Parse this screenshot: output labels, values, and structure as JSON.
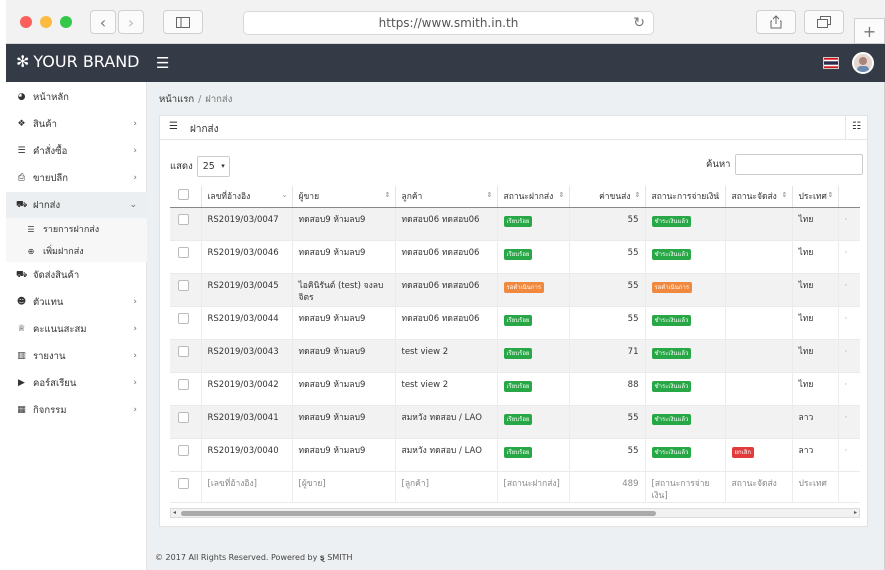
{
  "browser": {
    "url": "https://www.smith.in.th"
  },
  "topbar": {
    "brand": "YOUR BRAND"
  },
  "sidebar": {
    "items": [
      {
        "label": "หน้าหลัก",
        "icon": "dashboard-icon"
      },
      {
        "label": "สินค้า",
        "icon": "cubes-icon"
      },
      {
        "label": "คำสั่งซื้อ",
        "icon": "list-icon"
      },
      {
        "label": "ขายปลีก",
        "icon": "printer-icon"
      },
      {
        "label": "ฝากส่ง",
        "icon": "cart-icon"
      },
      {
        "label": "จัดส่งสินค้า",
        "icon": "truck-icon"
      },
      {
        "label": "ตัวแทน",
        "icon": "users-icon"
      },
      {
        "label": "คะแนนสะสม",
        "icon": "trophy-icon"
      },
      {
        "label": "รายงาน",
        "icon": "chart-icon"
      },
      {
        "label": "คอร์สเรียน",
        "icon": "play-icon"
      },
      {
        "label": "กิจกรรม",
        "icon": "calendar-icon"
      }
    ],
    "subitems": [
      {
        "label": "รายการฝากส่ง",
        "icon": "list-icon"
      },
      {
        "label": "เพิ่มฝากส่ง",
        "icon": "plus-circle-icon"
      }
    ]
  },
  "breadcrumb": {
    "home": "หน้าแรก",
    "current": "ฝากส่ง"
  },
  "card": {
    "title": "ฝากส่ง"
  },
  "table_controls": {
    "show_label": "แสดง",
    "page_length": "25",
    "search_label": "ค้นหา"
  },
  "table": {
    "headers": [
      "เลขที่อ้างอิง",
      "ผู้ขาย",
      "ลูกค้า",
      "สถานะฝากส่ง",
      "ค่าขนส่ง",
      "สถานะการจ่ายเงิน",
      "สถานะจัดส่ง",
      "ประเทศ"
    ],
    "rows": [
      {
        "ref": "RS2019/03/0047",
        "seller": "ทดสอบ9 ห้ามลบ9",
        "customer": "ทดสอบ06 ทดสอบ06",
        "status": "เรียบร้อย",
        "status_color": "#27a745",
        "shipping": "55",
        "payment": "ชำระเงินแล้ว",
        "delivery": "",
        "country": "ไทย"
      },
      {
        "ref": "RS2019/03/0046",
        "seller": "ทดสอบ9 ห้ามลบ9",
        "customer": "ทดสอบ06 ทดสอบ06",
        "status": "เรียบร้อย",
        "status_color": "#27a745",
        "shipping": "55",
        "payment": "ชำระเงินแล้ว",
        "delivery": "",
        "country": "ไทย"
      },
      {
        "ref": "RS2019/03/0045",
        "seller": "ไอคินิรันต์ (test) จงลบ จิตร",
        "customer": "ทดสอบ06 ทดสอบ06",
        "status": "รอดำเนินการ",
        "status_color": "#f0883e",
        "shipping": "55",
        "payment": "รอดำเนินการ",
        "delivery": "",
        "country": "ไทย"
      },
      {
        "ref": "RS2019/03/0044",
        "seller": "ทดสอบ9 ห้ามลบ9",
        "customer": "ทดสอบ06 ทดสอบ06",
        "status": "เรียบร้อย",
        "status_color": "#27a745",
        "shipping": "55",
        "payment": "ชำระเงินแล้ว",
        "delivery": "",
        "country": "ไทย"
      },
      {
        "ref": "RS2019/03/0043",
        "seller": "ทดสอบ9 ห้ามลบ9",
        "customer": "test view 2",
        "status": "เรียบร้อย",
        "status_color": "#27a745",
        "shipping": "71",
        "payment": "ชำระเงินแล้ว",
        "delivery": "",
        "country": "ไทย"
      },
      {
        "ref": "RS2019/03/0042",
        "seller": "ทดสอบ9 ห้ามลบ9",
        "customer": "test view 2",
        "status": "เรียบร้อย",
        "status_color": "#27a745",
        "shipping": "88",
        "payment": "ชำระเงินแล้ว",
        "delivery": "",
        "country": "ไทย"
      },
      {
        "ref": "RS2019/03/0041",
        "seller": "ทดสอบ9 ห้ามลบ9",
        "customer": "สมหวัง ทดสอบ / LAO",
        "status": "เรียบร้อย",
        "status_color": "#27a745",
        "shipping": "55",
        "payment": "ชำระเงินแล้ว",
        "delivery": "",
        "country": "ลาว"
      },
      {
        "ref": "RS2019/03/0040",
        "seller": "ทดสอบ9 ห้ามลบ9",
        "customer": "สมหวัง ทดสอบ / LAO",
        "status": "เรียบร้อย",
        "status_color": "#27a745",
        "shipping": "55",
        "payment": "ชำระเงินแล้ว",
        "delivery": "ยกเลิก",
        "country": "ลาว"
      }
    ],
    "footer": [
      "[เลขที่อ้างอิง]",
      "[ผู้ขาย]",
      "[ลูกค้า]",
      "[สถานะฝากส่ง]",
      "489",
      "[สถานะการจ่ายเงิน]",
      "สถานะจัดส่ง",
      "ประเทศ"
    ]
  },
  "footer": {
    "text": "© 2017 All Rights Reserved. Powered by",
    "brand": "SMITH"
  }
}
